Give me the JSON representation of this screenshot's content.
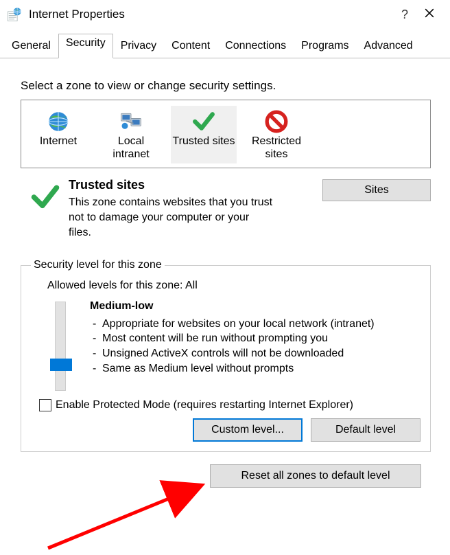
{
  "window": {
    "title": "Internet Properties"
  },
  "tabs": [
    "General",
    "Security",
    "Privacy",
    "Content",
    "Connections",
    "Programs",
    "Advanced"
  ],
  "selected_tab": 1,
  "zone_prompt": "Select a zone to view or change security settings.",
  "zones": [
    {
      "label": "Internet"
    },
    {
      "label": "Local intranet"
    },
    {
      "label": "Trusted sites"
    },
    {
      "label": "Restricted sites"
    }
  ],
  "selected_zone": 2,
  "zone_detail": {
    "title": "Trusted sites",
    "desc": "This zone contains websites that you trust not to damage your computer or your files.",
    "sites_btn": "Sites"
  },
  "group_label": "Security level for this zone",
  "allowed": "Allowed levels for this zone: All",
  "level": {
    "name": "Medium-low",
    "points": [
      "Appropriate for websites on your local network (intranet)",
      "Most content will be run without prompting you",
      "Unsigned ActiveX controls will not be downloaded",
      "Same as Medium level without prompts"
    ],
    "slider_pos_pct": 64
  },
  "protected_mode": {
    "checked": false,
    "label": "Enable Protected Mode (requires restarting Internet Explorer)"
  },
  "buttons": {
    "custom": "Custom level...",
    "default": "Default level",
    "reset": "Reset all zones to default level"
  }
}
